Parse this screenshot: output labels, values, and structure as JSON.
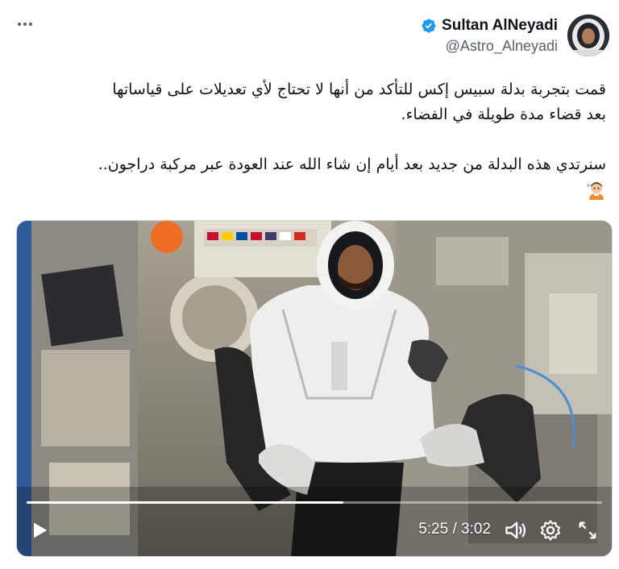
{
  "author": {
    "display_name": "Sultan AlNeyadi",
    "handle": "@Astro_Alneyadi",
    "verified_icon": "verified-badge-icon",
    "avatar_icon": "astronaut-avatar"
  },
  "tweet": {
    "line1": "قمت بتجربة بدلة سبيس إكس للتأكد من أنها لا تحتاج لأي تعديلات على قياساتها",
    "line2": "بعد قضاء مدة طويلة في الفضاء.",
    "line3": "سنرتدي هذه البدلة من جديد بعد أيام إن شاء الله عند العودة عبر مركبة دراجون..",
    "emoji": "man-astronaut-emoji"
  },
  "video": {
    "time_display": "5:25 / 3:02",
    "progress_fraction": 0.55,
    "icons": {
      "play": "play-icon",
      "volume": "volume-icon",
      "settings": "gear-icon",
      "fullscreen": "fullscreen-icon",
      "more": "more-horizontal-icon"
    }
  },
  "colors": {
    "verified_blue": "#1d9bf0",
    "text_primary": "#0f1419",
    "text_secondary": "#536471"
  }
}
